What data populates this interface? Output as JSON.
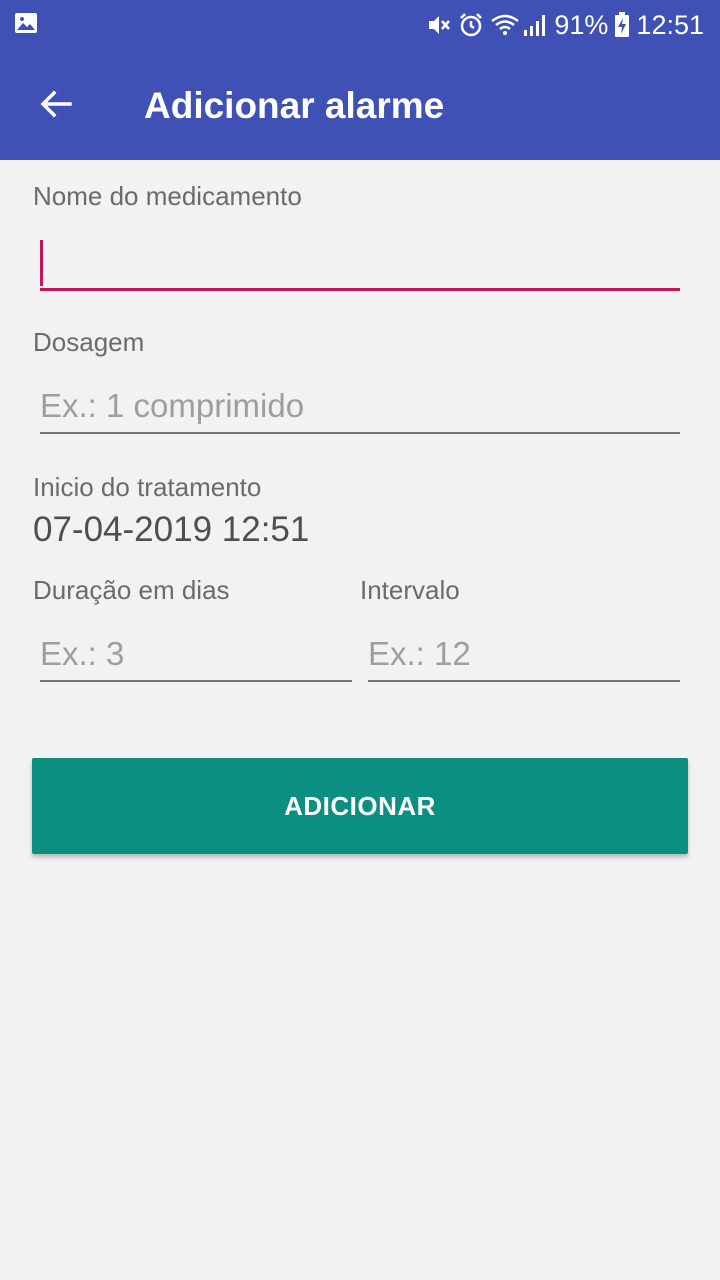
{
  "statusbar": {
    "battery": "91%",
    "time": "12:51",
    "icons": [
      "image-icon",
      "mute-icon",
      "alarm-icon",
      "wifi-icon",
      "signal-icon",
      "battery-charging-icon"
    ]
  },
  "toolbar": {
    "title": "Adicionar alarme",
    "back_icon": "arrow-back-icon"
  },
  "form": {
    "medication_label": "Nome do medicamento",
    "medication_value": "",
    "dosage_label": "Dosagem",
    "dosage_placeholder": "Ex.: 1 comprimido",
    "start_label": "Inicio do tratamento",
    "start_value": "07-04-2019 12:51",
    "duration_label": "Duração em dias",
    "duration_placeholder": "Ex.: 3",
    "interval_label": "Intervalo",
    "interval_placeholder": "Ex.: 12"
  },
  "actions": {
    "add_label": "ADICIONAR"
  },
  "colors": {
    "primary": "#3f51b5",
    "accent": "#c2185b",
    "button": "#0a8f80",
    "background": "#f2f2f2"
  }
}
